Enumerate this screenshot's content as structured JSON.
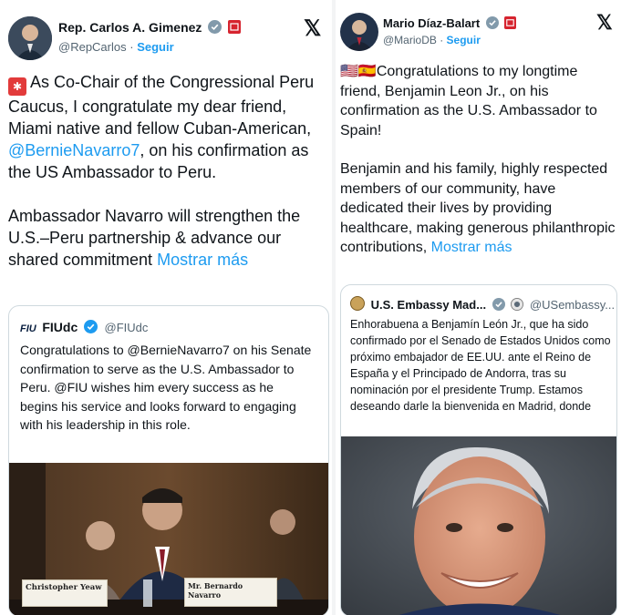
{
  "left_tweet": {
    "author_name": "Rep. Carlos A. Gimenez",
    "handle": "@RepCarlos",
    "follow_label": "Seguir",
    "siren_emoji": "🚨",
    "paragraph1_pre": "As Co-Chair of the Congressional Peru Caucus, I congratulate my dear friend, Miami native and fellow Cuban-American, ",
    "mention": "@BernieNavarro7",
    "paragraph1_post": ", on his confirmation as the US Ambassador to Peru.",
    "paragraph2": "Ambassador Navarro will strengthen the U.S.–Peru partnership & advance our shared commitment",
    "show_more": "Mostrar más",
    "quote": {
      "logo_text": "FIU",
      "author_name": "FIUdc",
      "handle": "@FIUdc",
      "text": "Congratulations to @BernieNavarro7 on his Senate confirmation to serve as the U.S. Ambassador to Peru. @FIU wishes him every success as he begins his service and looks forward to engaging with his leadership in this role.",
      "nameplate_left": "Christopher Yeaw",
      "nameplate_right": "Mr. Bernardo Navarro"
    }
  },
  "right_tweet": {
    "author_name": "Mario Díaz-Balart",
    "handle": "@MarioDB",
    "follow_label": "Seguir",
    "flags": "🇺🇸🇪🇸",
    "paragraph1": "Congratulations to my longtime friend, Benjamin Leon Jr., on his confirmation as the U.S. Ambassador to Spain!",
    "paragraph2": "Benjamin and his family, highly respected members of our community, have dedicated their lives by providing healthcare, making generous philanthropic contributions,",
    "show_more": "Mostrar más",
    "quote": {
      "author_name": "U.S. Embassy Mad...",
      "handle": "@USembassy...",
      "text": "Enhorabuena a Benjamín León Jr., que ha sido confirmado por el Senado de Estados Unidos como próximo embajador de EE.UU. ante el Reino de España y el Principado de Andorra, tras su nominación por el presidente Trump. Estamos deseando darle la bienvenida en Madrid, donde"
    }
  },
  "colors": {
    "verified": "#1d9bf0",
    "link": "#1d9bf0",
    "gov_badge": "#d6242f",
    "muted": "#536471"
  },
  "icons": [
    "verified-badge-icon",
    "government-badge-icon",
    "x-logo-icon",
    "siren-icon",
    "flag-icons",
    "embassy-seal-icon"
  ]
}
